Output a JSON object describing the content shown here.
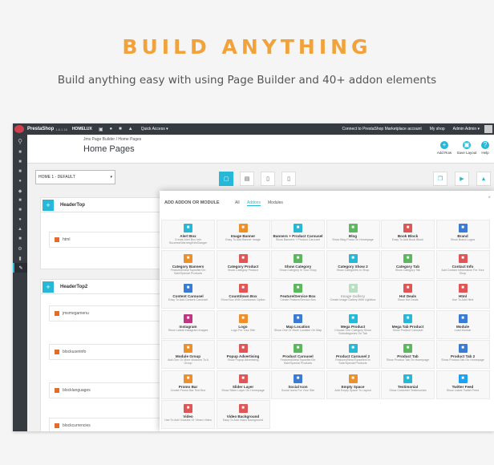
{
  "banner": {
    "headline": "BUILD ANYTHING",
    "subline": "Build anything easy with using Page Builder and 40+ addon elements"
  },
  "colors": {
    "accent": "#f2a23a",
    "primary": "#25b9d7",
    "topbar": "#363a41"
  },
  "topbar": {
    "brand": "PrestaShop",
    "version": "1.6.1.16",
    "shop": "HOMELUX",
    "quick_access": "Quick Access ▾",
    "connect": "Connect to PrestaShop Marketplace account",
    "my_shop": "My shop",
    "admin": "Admin Admin ▾"
  },
  "header": {
    "breadcrumb": "Jms Page Builder  /  Home Pages",
    "title": "Home Pages",
    "buttons": [
      {
        "label": "Add Row",
        "icon": "plus-circle-icon"
      },
      {
        "label": "Save Layout",
        "icon": "save-icon"
      },
      {
        "label": "Help",
        "icon": "question-icon"
      }
    ]
  },
  "layout_select": {
    "value": "HOME 1 - DEFAULT"
  },
  "rows": [
    {
      "title": "HeaderTop",
      "widgets": [
        "html"
      ]
    },
    {
      "title": "HeaderTop2",
      "widgets": [
        "jmsmegamenu",
        "blockuserinfo",
        "blocklanguages",
        "blockcurrencies"
      ]
    }
  ],
  "modal": {
    "title": "ADD ADDON OR MODULE",
    "tabs": [
      "All",
      "Addons",
      "Modules"
    ],
    "active_tab": "Addons",
    "close": "×",
    "items": [
      {
        "name": "Alert Box",
        "desc": "Create Alert Box Info Success/Warning/Info/Danger",
        "color": "#25b9d7",
        "icon": "bell-icon"
      },
      {
        "name": "Image Banner",
        "desc": "Easy To Add Banner Image",
        "color": "#ef8f2a",
        "icon": "image-icon"
      },
      {
        "name": "Banners + Product Carousel",
        "desc": "Show Banners + Product Carousel",
        "color": "#25b9d7",
        "icon": "banner-icon"
      },
      {
        "name": "Blog",
        "desc": "Show Blog Posts On Homepage",
        "color": "#5cb85c",
        "icon": "blog-icon"
      },
      {
        "name": "Book Block",
        "desc": "Easy To Add Book Block",
        "color": "#e05555",
        "icon": "book-icon"
      },
      {
        "name": "Brand",
        "desc": "Show Brand Logos",
        "color": "#3a7bd5",
        "icon": "brand-icon"
      },
      {
        "name": "Category Banners",
        "desc": "Featured/New/Topseller/On Sale/Special Products",
        "color": "#ef8f2a",
        "icon": "category-icon"
      },
      {
        "name": "Category Product",
        "desc": "Show Category Product",
        "color": "#e05555",
        "icon": "product-icon"
      },
      {
        "name": "Show Category",
        "desc": "Show Category In Your Shop",
        "color": "#5cb85c",
        "icon": "folder-icon"
      },
      {
        "name": "Category Show 2",
        "desc": "Show Categories In Shop",
        "color": "#25b9d7",
        "icon": "folder2-icon"
      },
      {
        "name": "Category Tab",
        "desc": "Show Category Tab",
        "color": "#5cb85c",
        "icon": "tab-icon"
      },
      {
        "name": "Contact Info",
        "desc": "Add Contact Information For Your Shop",
        "color": "#e05555",
        "icon": "contact-icon"
      },
      {
        "name": "Content Carousel",
        "desc": "Easy To Add Content Carousel",
        "color": "#3a7bd5",
        "icon": "carousel-icon"
      },
      {
        "name": "Countdown Box",
        "desc": "Show Box With Countdown Option",
        "color": "#e05555",
        "icon": "clock-icon"
      },
      {
        "name": "Feature/Service Box",
        "desc": "Create Feature/Service Box",
        "color": "#5cb85c",
        "icon": "feature-icon"
      },
      {
        "name": "Image Gallery",
        "desc": "Create Image Gallery With Lightbox",
        "color": "#b8e0c0",
        "icon": "gallery-icon",
        "muted": true
      },
      {
        "name": "Hot Deals",
        "desc": "Show Hot Deals",
        "color": "#e05555",
        "icon": "fire-icon"
      },
      {
        "name": "Html",
        "desc": "Use To Add Html",
        "color": "#e05555",
        "icon": "html-icon"
      },
      {
        "name": "Instagram",
        "desc": "Show Latest Instagram Images",
        "color": "#c13584",
        "icon": "instagram-icon"
      },
      {
        "name": "Logo",
        "desc": "Logo For Your Site",
        "color": "#ef8f2a",
        "icon": "logo-icon"
      },
      {
        "name": "Map Location",
        "desc": "Show One Or More Location On Map",
        "color": "#3a7bd5",
        "icon": "map-icon"
      },
      {
        "name": "Mega Product",
        "desc": "Choose One Category Show Subcategories On Tab",
        "color": "#25b9d7",
        "icon": "mega-icon"
      },
      {
        "name": "Mega Tab Product",
        "desc": "Show Product Carousel",
        "color": "#25b9d7",
        "icon": "megatab-icon"
      },
      {
        "name": "Module",
        "desc": "Load Module",
        "color": "#3a7bd5",
        "icon": "module-icon"
      },
      {
        "name": "Module Group",
        "desc": "Add One Or More Modules To A Group",
        "color": "#ef8f2a",
        "icon": "group-icon"
      },
      {
        "name": "Popup Advertising",
        "desc": "Show Popup Advertising",
        "color": "#e05555",
        "icon": "popup-icon"
      },
      {
        "name": "Product Carousel",
        "desc": "Featured/New/Topseller/On Sale/Special Products",
        "color": "#5cb85c",
        "icon": "product-carousel-icon"
      },
      {
        "name": "Product Carousel 2",
        "desc": "Featured/New/Topseller/On Sale/Special Products",
        "color": "#25b9d7",
        "icon": "product-carousel2-icon"
      },
      {
        "name": "Product Tab",
        "desc": "Show Product Tab On Homepage",
        "color": "#5cb85c",
        "icon": "product-tab-icon"
      },
      {
        "name": "Product Tab 2",
        "desc": "Show Product Tab On Homepage",
        "color": "#3a7bd5",
        "icon": "product-tab2-icon"
      },
      {
        "name": "Promo Bar",
        "desc": "Create Promo Bar Text Box",
        "color": "#ef8f2a",
        "icon": "promo-icon"
      },
      {
        "name": "Slider Layer",
        "desc": "Show Slider Layer On Homepage",
        "color": "#e05555",
        "icon": "slider-icon"
      },
      {
        "name": "Social Icon",
        "desc": "Social Icons For Your Site",
        "color": "#3a7bd5",
        "icon": "social-icon"
      },
      {
        "name": "Empty Space",
        "desc": "Add Empty Space To Layout",
        "color": "#ef8f2a",
        "icon": "space-icon"
      },
      {
        "name": "Testimonial",
        "desc": "Show Customer Testimonials",
        "color": "#25b9d7",
        "icon": "quote-icon"
      },
      {
        "name": "Twitter Feed",
        "desc": "Show Latest Twitter Feed",
        "color": "#1da1f2",
        "icon": "twitter-icon"
      },
      {
        "name": "Video",
        "desc": "Use To Add Youtube Or Vimeo Video",
        "color": "#e05555",
        "icon": "video-icon"
      },
      {
        "name": "Video Background",
        "desc": "Easy To Add Video Background",
        "color": "#e05555",
        "icon": "video-bg-icon"
      }
    ]
  }
}
